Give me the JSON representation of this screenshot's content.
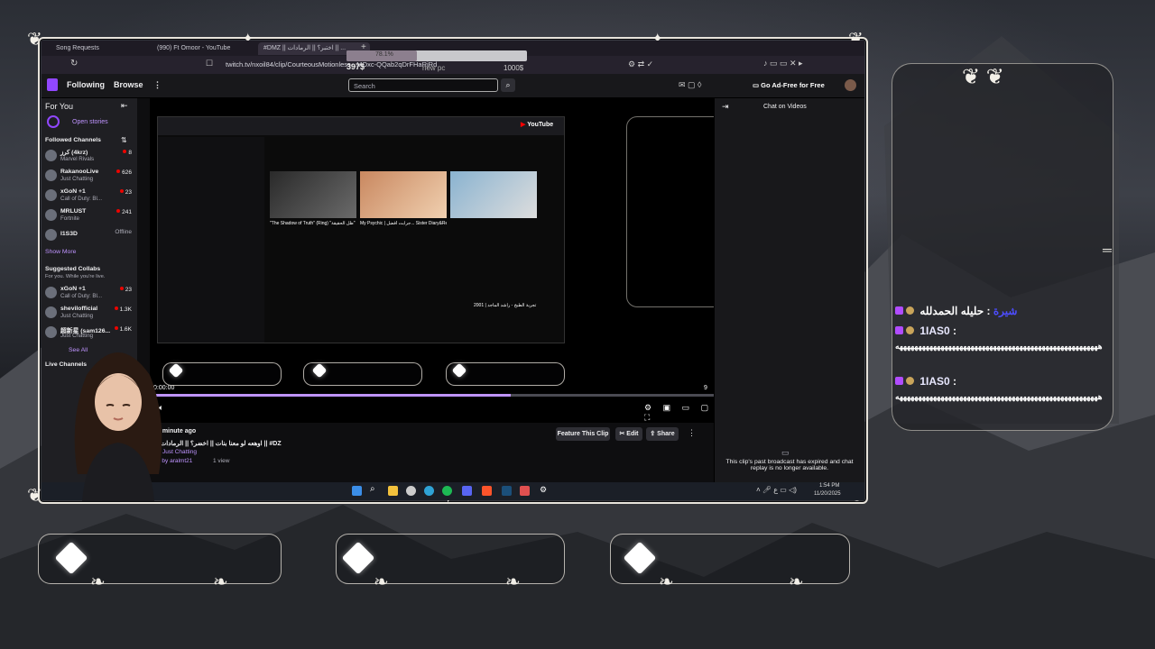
{
  "browser": {
    "tabs": [
      "Song Requests",
      "(990) Ft Omoor - YouTube",
      "#DMZ || اختبر؟ || الرمادات || ..."
    ],
    "url": "twitch.tv/nxoil84/clip/CourteousMotionless...MOxc-QQab2qDrFHaRjRd",
    "overlay_counter": "397$",
    "overlay_label_new_pc": "new pc",
    "overlay_goal": "1000$",
    "overlay_pct": "78.1%"
  },
  "twitch_nav": {
    "following": "Following",
    "browse": "Browse",
    "more": "⋮",
    "search_placeholder": "Search",
    "ad_free": "Go Ad-Free for Free"
  },
  "sidebar": {
    "for_you": "For You",
    "open_stories": "Open stories",
    "followed_header": "Followed Channels",
    "followed": [
      {
        "name": "كرز (4krz)",
        "game": "Marvel Rivals",
        "viewers": "8"
      },
      {
        "name": "RakanooLive",
        "game": "Just Chatting",
        "viewers": "626"
      },
      {
        "name": "xGoN +1",
        "game": "Call of Duty: Bl...",
        "viewers": "23"
      },
      {
        "name": "MRLUST",
        "game": "Fortnite",
        "viewers": "241"
      },
      {
        "name": "I1S3D",
        "game": "",
        "viewers": "Offline"
      }
    ],
    "show_more": "Show More",
    "suggested_header": "Suggested Collabs",
    "suggested_sub": "For you. While you're live.",
    "suggested": [
      {
        "name": "xGoN +1",
        "game": "Call of Duty: Bl...",
        "viewers": "23"
      },
      {
        "name": "shevilofficial",
        "game": "Just Chatting",
        "viewers": "1.3K"
      },
      {
        "name": "超新星 (sam126...",
        "game": "Just Chatting",
        "viewers": "1.6K"
      }
    ],
    "see_all": "See All",
    "live_channels": "Live Channels"
  },
  "player": {
    "time": "0:00:00",
    "end": "9",
    "progress": 0.64,
    "inner_titles": [
      "\"The Shadow of Truth\" (Ring) \"ظل الحقيقة\"",
      "My Psychic | جرابت أفضل... Sister Diary&Review of the Best Perfume",
      "تجربة الطبخ - راشد الماجد | 2001"
    ]
  },
  "clip": {
    "age": "1 minute ago",
    "title": "اوهعه لو معنا بنات || اخضر؟ || الرمادات؟ || #DZ",
    "category": "Just Chatting",
    "clipped_by": "d by aralmt21",
    "views": "1 view",
    "feature_btn": "Feature This Clip",
    "edit_btn": "Edit",
    "share_btn": "Share"
  },
  "chat_panel": {
    "header": "Chat on Videos",
    "expired_msg": "This clip's past broadcast has expired and chat replay is no longer available."
  },
  "taskbar": {
    "time": "1:54 PM",
    "date": "11/20/2025"
  },
  "overlay_chat": [
    {
      "user": "شيرة",
      "text": ": حليله الحمدلله"
    },
    {
      "user": "1IAS0",
      "text": " :",
      "body": "ههههههههههههههههههههههههههههههههههههههههههههههههههههههه"
    },
    {
      "user": "1IAS0",
      "text": " :",
      "body": "ههههههههههههههههههههههههههههههههههههههههههههههههههههههه"
    }
  ],
  "colors": {
    "twitch_purple": "#9147ff",
    "progress": "#bf94ff",
    "live_red": "#eb0400",
    "frame": "#e8e4dc"
  }
}
